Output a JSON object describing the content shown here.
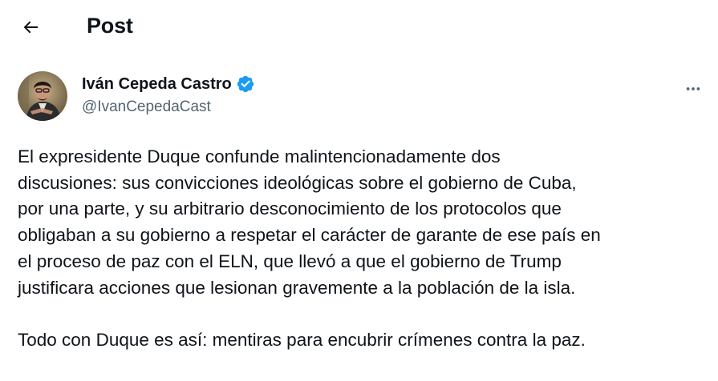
{
  "header": {
    "back_icon": "arrow-left-icon",
    "title": "Post"
  },
  "author": {
    "display_name": "Iván Cepeda Castro",
    "handle": "@IvanCepedaCast",
    "verified_icon": "verified-badge-icon",
    "verified_color": "#1d9bf0"
  },
  "more_icon": "more-horizontal-icon",
  "post": {
    "paragraph1_lines": [
      "El expresidente Duque confunde malintencionadamente dos",
      "discusiones: sus convicciones ideológicas sobre el gobierno de Cuba,",
      "por una parte, y su arbitrario desconocimiento de los protocolos que",
      "obligaban a su gobierno a respetar el carácter de garante de ese país en",
      "el proceso de paz con el ELN, que llevó a que el gobierno de Trump",
      "justificara acciones que lesionan gravemente a la población de la isla."
    ],
    "paragraph2": "Todo con Duque es así: mentiras para encubrir crímenes contra la paz."
  }
}
